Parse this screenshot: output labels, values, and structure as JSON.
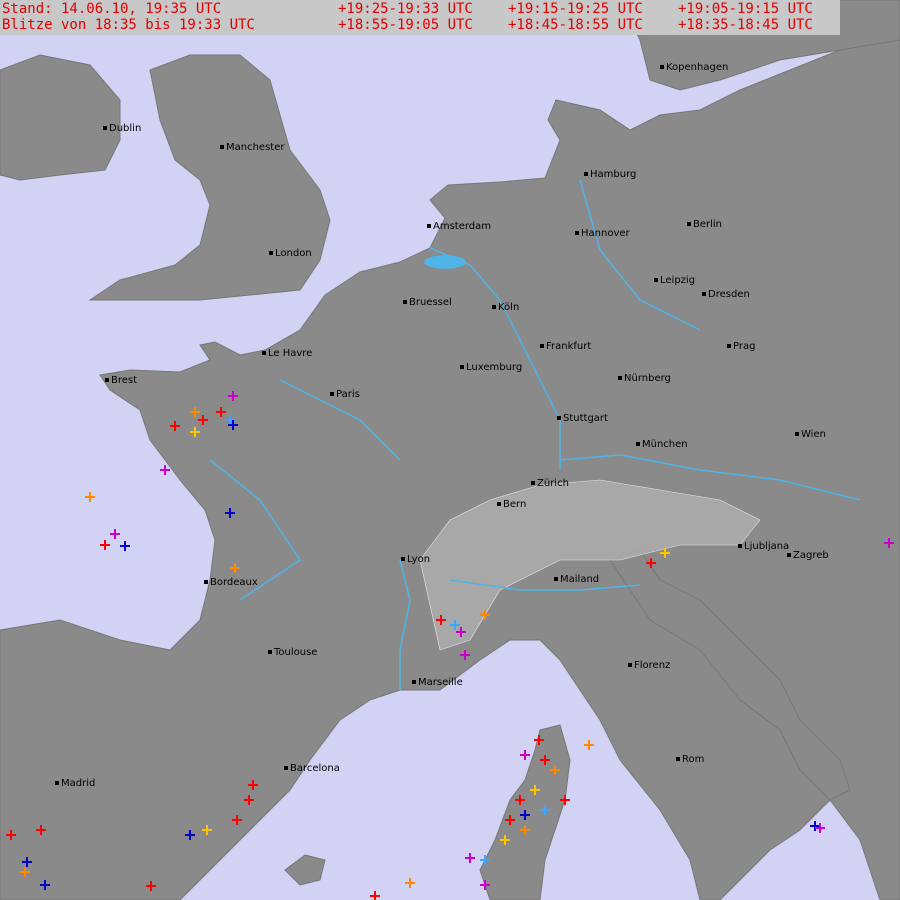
{
  "header": {
    "stand": "Stand: 14.06.10, 19:35 UTC",
    "range": "Blitze von 18:35 bis 19:33 UTC",
    "legend": [
      {
        "label": "+19:25-19:33 UTC",
        "color": "#ff0000"
      },
      {
        "label": "+19:15-19:25 UTC",
        "color": "#ff8800"
      },
      {
        "label": "+19:05-19:15 UTC",
        "color": "#ffc400"
      },
      {
        "label": "+18:55-19:05 UTC",
        "color": "#3aa6ff"
      },
      {
        "label": "+18:45-18:55 UTC",
        "color": "#0000cc"
      },
      {
        "label": "+18:35-18:45 UTC",
        "color": "#cc00cc"
      }
    ]
  },
  "cities": [
    "Kopenhagen",
    "Dublin",
    "Manchester",
    "Hamburg",
    "Amsterdam",
    "Hannover",
    "Berlin",
    "London",
    "Leipzig",
    "Bruessel",
    "Köln",
    "Dresden",
    "Le Havre",
    "Frankfurt",
    "Prag",
    "Luxemburg",
    "Brest",
    "Paris",
    "Nürnberg",
    "Stuttgart",
    "München",
    "Wien",
    "Zürich",
    "Bern",
    "Ljubljana",
    "Zagreb",
    "Lyon",
    "Mailand",
    "Bordeaux",
    "Toulouse",
    "Marseille",
    "Florenz",
    "Barcelona",
    "Rom",
    "Madrid"
  ],
  "colors": {
    "sea": "#d2d2f5",
    "land": "#8a8a8a",
    "river": "#4fb4e8",
    "legend_bg": "#c8c8c8",
    "legend_text": "#e00000"
  }
}
